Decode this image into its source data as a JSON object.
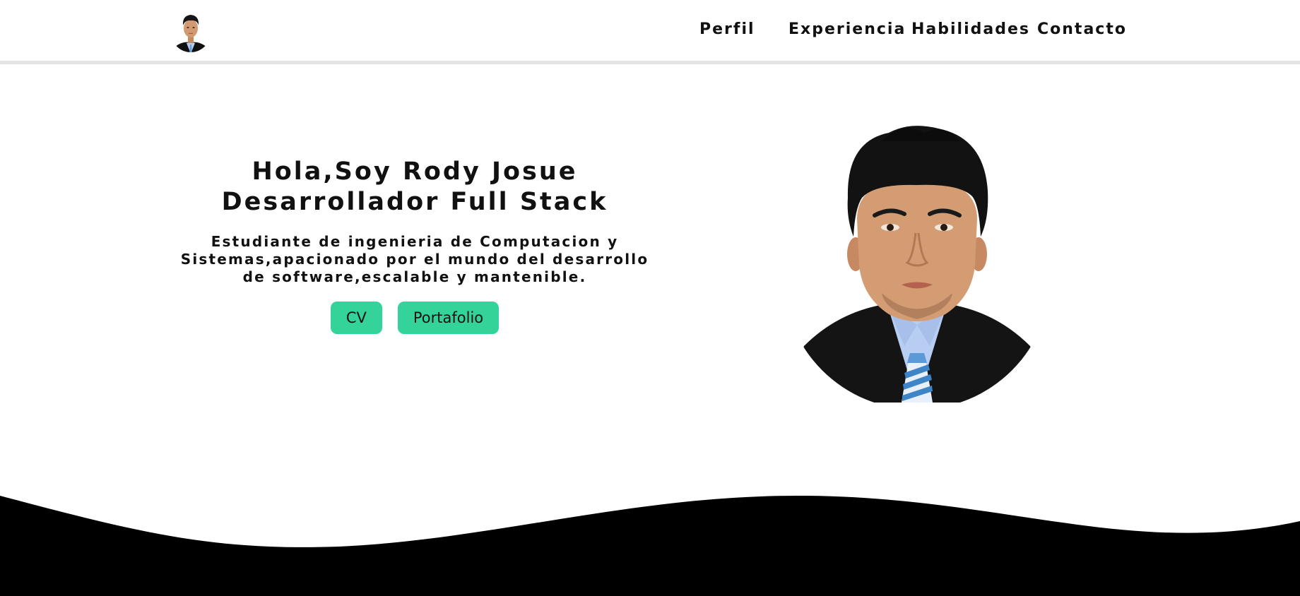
{
  "header": {
    "logo_icon": "profile-avatar-icon",
    "nav": [
      {
        "label": "Perfil"
      },
      {
        "label": "Experiencia"
      },
      {
        "label": "Habilidades"
      },
      {
        "label": "Contacto"
      }
    ]
  },
  "hero": {
    "title_line1": "Hola,Soy Rody Josue",
    "title_line2": "Desarrollador Full Stack",
    "subtitle": "Estudiante de ingenieria de Computacion y Sistemas,apacionado por el mundo del desarrollo de software,escalable y mantenible.",
    "buttons": [
      {
        "label": "CV"
      },
      {
        "label": "Portafolio"
      }
    ],
    "button_color": "#34d399",
    "portrait_icon": "profile-portrait-icon"
  },
  "footer": {
    "wave_color": "#000000"
  }
}
